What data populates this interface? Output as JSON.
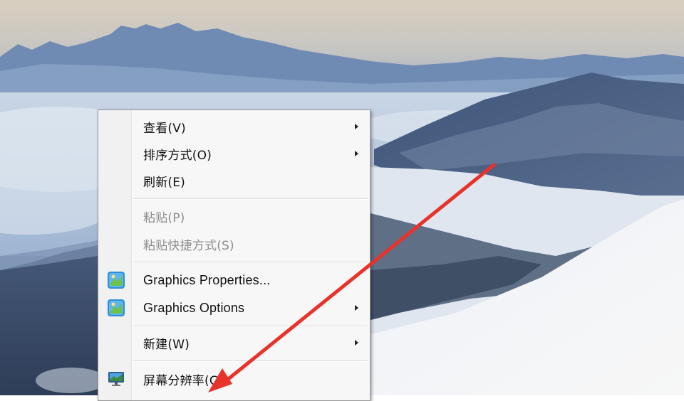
{
  "context_menu": {
    "items": [
      {
        "label": "查看(V)",
        "has_submenu": true,
        "disabled": false
      },
      {
        "label": "排序方式(O)",
        "has_submenu": true,
        "disabled": false
      },
      {
        "label": "刷新(E)",
        "has_submenu": false,
        "disabled": false
      },
      {
        "label": "粘贴(P)",
        "has_submenu": false,
        "disabled": true
      },
      {
        "label": "粘贴快捷方式(S)",
        "has_submenu": false,
        "disabled": true
      },
      {
        "label": "Graphics Properties...",
        "has_submenu": false,
        "disabled": false,
        "icon": "intel-graphics-icon"
      },
      {
        "label": "Graphics Options",
        "has_submenu": true,
        "disabled": false,
        "icon": "intel-graphics-icon"
      },
      {
        "label": "新建(W)",
        "has_submenu": true,
        "disabled": false
      },
      {
        "label": "屏幕分辨率(C)",
        "has_submenu": false,
        "disabled": false,
        "icon": "monitor-icon"
      }
    ]
  },
  "annotation": {
    "color": "#e8322a"
  },
  "wallpaper": {
    "subject": "snowy-mountains"
  }
}
